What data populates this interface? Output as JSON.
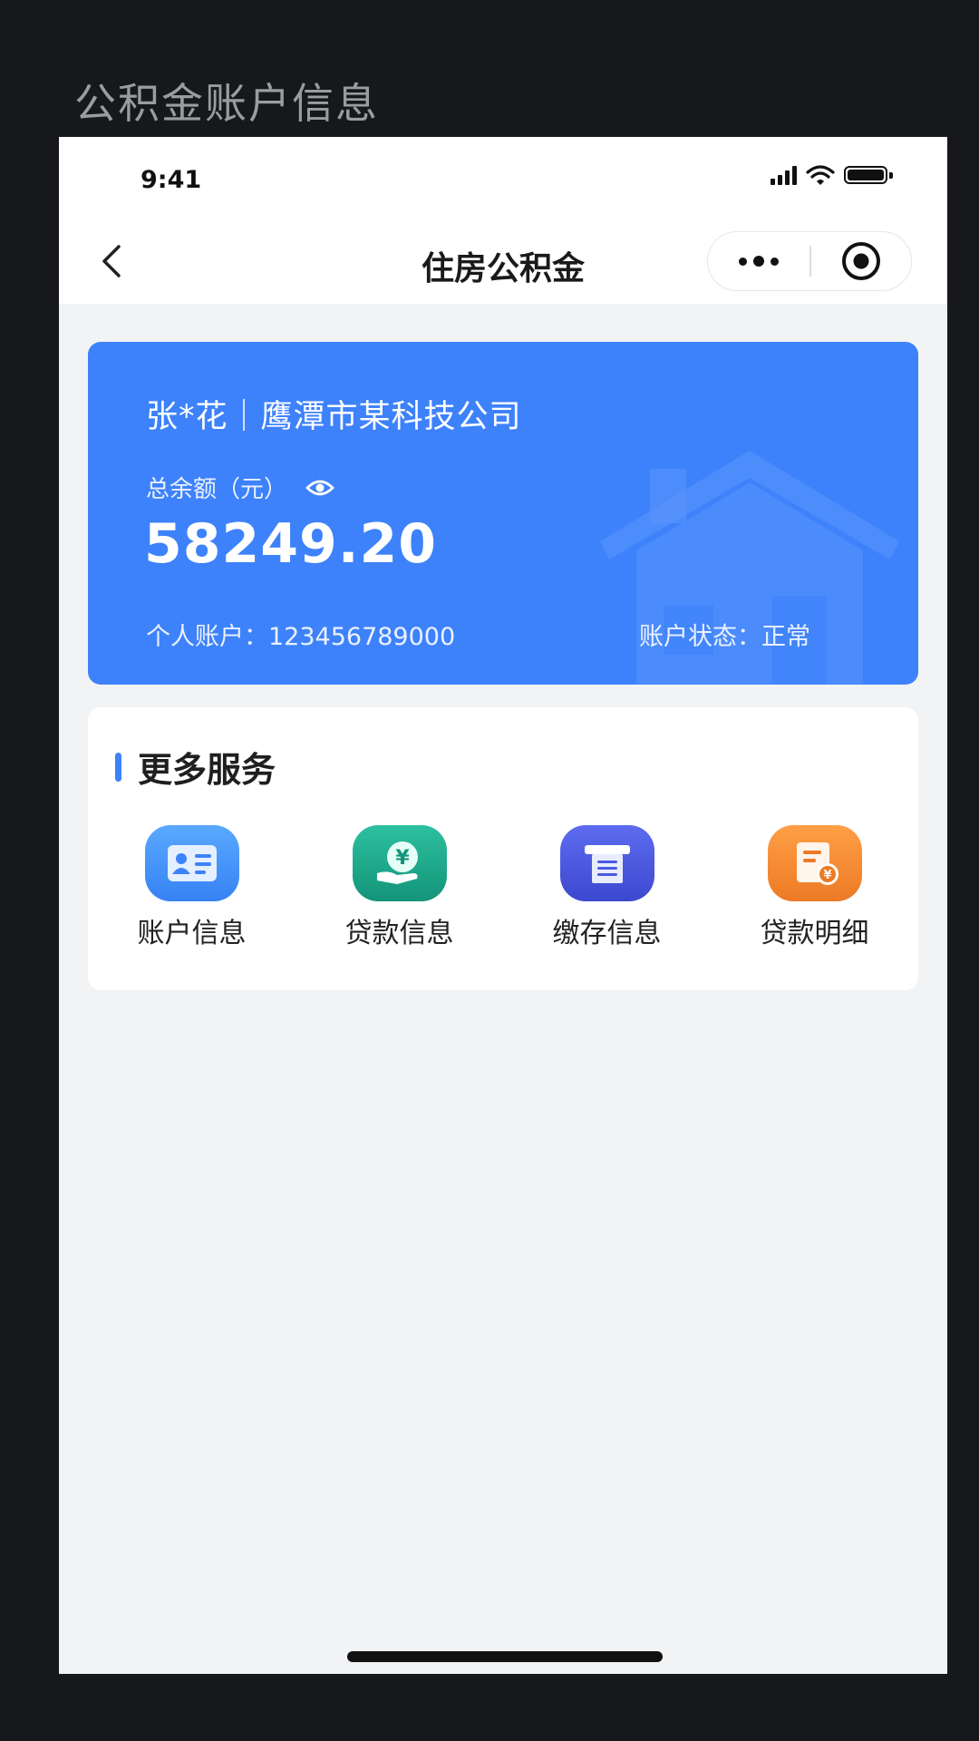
{
  "caption": "公积金账户信息",
  "status_bar": {
    "time": "9:41"
  },
  "nav": {
    "title": "住房公积金"
  },
  "card": {
    "owner": "张*花｜鹰潭市某科技公司",
    "balance_label": "总余额（元）",
    "balance": "58249.20",
    "account": "个人账户：123456789000",
    "status": "账户状态：正常",
    "color": "#3d82fb"
  },
  "services": {
    "title": "更多服务",
    "items": [
      {
        "label": "账户信息",
        "icon": "id-card-icon",
        "color": "#3f8ef5"
      },
      {
        "label": "贷款信息",
        "icon": "money-hand-icon",
        "color": "#1aa58a"
      },
      {
        "label": "缴存信息",
        "icon": "receipt-printer-icon",
        "color": "#4a5ae0"
      },
      {
        "label": "贷款明细",
        "icon": "bill-detail-icon",
        "color": "#f08a34"
      }
    ]
  }
}
